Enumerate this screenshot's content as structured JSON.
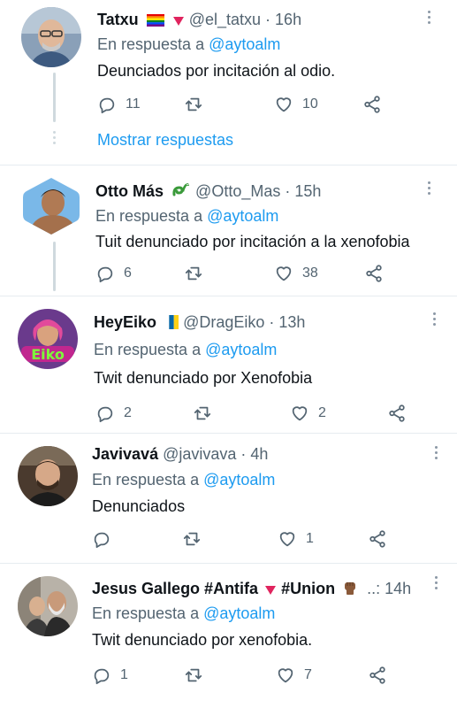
{
  "replying_prefix": "En respuesta a",
  "colors": {
    "mention": "#1d9bf0",
    "secondary": "#536471",
    "divider": "#e6ecf0"
  },
  "tweets": [
    {
      "name": "Tatxu",
      "handle": "@el_tatxu",
      "time": "16h",
      "badges": [
        "rainbow-flag-icon",
        "red-triangle-icon"
      ],
      "mention": "@aytoalm",
      "text": "Deunciados por incitación al odio.",
      "replies": "11",
      "retweets": "",
      "likes": "10",
      "show_replies": "Mostrar respuestas"
    },
    {
      "name": "Otto Más",
      "handle": "@Otto_Mas",
      "time": "15h",
      "badges": [
        "dragon-icon"
      ],
      "mention": "@aytoalm",
      "text": "Tuit denunciado por incitación a la xenofobia",
      "replies": "6",
      "retweets": "",
      "likes": "38"
    },
    {
      "name": "HeyEiko",
      "handle": "@DragEiko",
      "time": "13h",
      "badges": [
        "canary-islands-flag-icon"
      ],
      "mention": "@aytoalm",
      "text": "Twit denunciado por Xenofobia",
      "replies": "2",
      "retweets": "",
      "likes": "2"
    },
    {
      "name": "Javivavá",
      "handle": "@javivava",
      "time": "4h",
      "badges": [],
      "mention": "@aytoalm",
      "text": "Denunciados",
      "replies": "",
      "retweets": "",
      "likes": "1"
    },
    {
      "name": "Jesus Gallego #Antifa",
      "name2": "#Union",
      "handle_truncated": "..:",
      "time": "14h",
      "badges": [
        "red-triangle-icon",
        "raised-fist-icon"
      ],
      "mention": "@aytoalm",
      "text": "Twit denunciado por xenofobia.",
      "replies": "1",
      "retweets": "",
      "likes": "7"
    }
  ],
  "sep": " · "
}
